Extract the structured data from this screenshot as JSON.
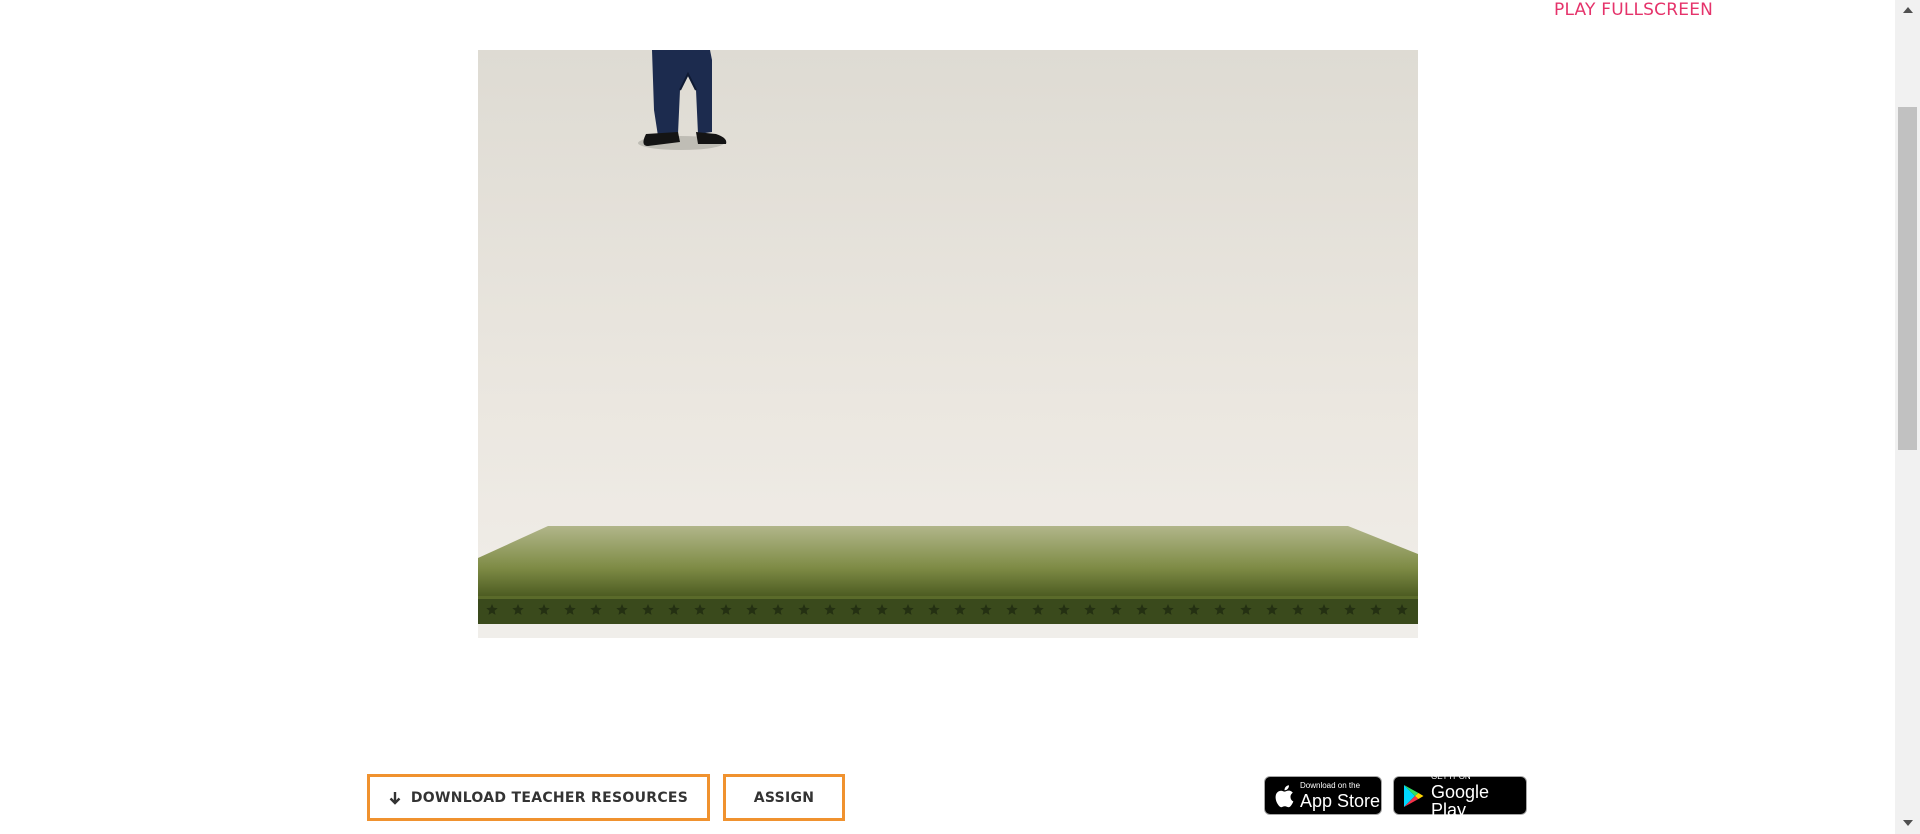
{
  "header": {
    "fullscreen_label": "PLAY FULLSCREEN"
  },
  "game": {
    "name_icon": "character-legs",
    "platform_color": "#6d7b35",
    "platform_top_color": "#a9b07a",
    "star_color": "#222a12"
  },
  "actions": {
    "download_label": "DOWNLOAD TEACHER RESOURCES",
    "download_icon": "arrow-down-icon",
    "assign_label": "ASSIGN",
    "border_color": "#f0922f"
  },
  "stores": {
    "app_store": {
      "small": "Download on the",
      "big": "App Store"
    },
    "google_play": {
      "small": "GET IT ON",
      "big": "Google Play"
    }
  }
}
